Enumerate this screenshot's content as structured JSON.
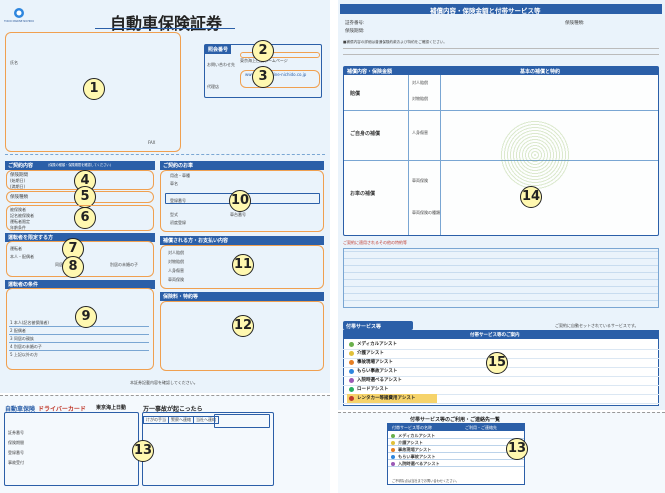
{
  "left_page": {
    "title": "自動車保険証券",
    "logo_text": "TOKIO MARINE NICHIDO",
    "contact_header": "照会番号",
    "contact_label": "お問い合わせ先",
    "contact_person": "代理店",
    "contact_web_header": "東京海上日動ホームページ",
    "contact_url": "www.tokiomarine-nichido.co.jp",
    "insured_label": "氏名",
    "fax_label": "FAX",
    "contract_section": "ご契約内容",
    "contract_note": "(保険の種類・保険期間を確認してください)",
    "rows_4": [
      "保険期間",
      "(始期日)",
      "(満期日)"
    ],
    "row_5": "保険種類",
    "rows_6": [
      "被保険者",
      "記名被保険者",
      "運転者限定",
      "年齢条件"
    ],
    "section_7": "運転者を限定する方",
    "rows_8": [
      "運転者",
      "本人・配偶者",
      "同居の親族",
      "別居の未婚の子"
    ],
    "section_9": "運転者の条件",
    "rows_9": [
      "1 本人(記名被保険者)",
      "2 配偶者",
      "3 同居の親族",
      "4 別居の未婚の子",
      "5 上記以外の方"
    ],
    "car_section": "ご契約のお車",
    "car_rows": [
      "用途・車種",
      "車名",
      "型式",
      "登録番号",
      "初度登録",
      "車台番号"
    ],
    "coverage_section": "補償される方・お支払い内容",
    "coverage_rows": [
      "対人賠償",
      "対物賠償",
      "人身傷害",
      "車両保険"
    ],
    "premium_section": "保険料・特約等",
    "bottom_note": "本証券記載内容を確認してください。",
    "num_labels": [
      "1",
      "2",
      "3",
      "4",
      "5",
      "6",
      "7",
      "8",
      "9",
      "10",
      "11",
      "12"
    ]
  },
  "bottom_left": {
    "card_title": "自動車保険",
    "card_subtitle": "ドライバーカード",
    "card_company": "東京海上日動",
    "accident_title": "万一事故が起こったら",
    "accident_btns": [
      "けがの手当",
      "警察へ連絡",
      "当社へ連絡"
    ],
    "card_rows": [
      "証券番号",
      "保険期間",
      "登録番号",
      "事故受付"
    ],
    "num_label": "13"
  },
  "right_page": {
    "title": "補償内容・保険金額と付帯サービス等",
    "ids": [
      "証券番号:",
      "保険期間:",
      "保険種類:"
    ],
    "notice": "■補償内容の詳細は普通保険約款および特約をご確認ください。",
    "table_header": "補償内容・保険金額",
    "table_col": "基本の補償と特約",
    "rows": [
      {
        "label": "賠償",
        "sub": [
          "対人賠償",
          "対物賠償"
        ]
      },
      {
        "label": "ご自身の補償",
        "sub": [
          "人身傷害"
        ]
      },
      {
        "label": "お車の補償",
        "sub": [
          "車両保険",
          "車両保険の種類"
        ]
      }
    ],
    "special_notice": "ご契約に適用されるその他の特約等",
    "num_labels": [
      "14",
      "15"
    ]
  },
  "services": {
    "header": "付帯サービス等",
    "subheader": "付帯サービス等のご案内",
    "note": "ご契約に自動セットされているサービスです。",
    "items": [
      {
        "name": "メディカルアシスト",
        "color": "#6ab04c"
      },
      {
        "name": "介護アシスト",
        "color": "#e1c03a"
      },
      {
        "name": "事故現場アシスト",
        "color": "#e67e22"
      },
      {
        "name": "もらい事故アシスト",
        "color": "#2e86de"
      },
      {
        "name": "入院時選べるアシスト",
        "color": "#9b59b6"
      },
      {
        "name": "ロードアシスト",
        "color": "#27ae60"
      },
      {
        "name": "レンタカー等諸費用アシスト",
        "color": "#c0392b"
      }
    ]
  },
  "services_summary": {
    "header": "付帯サービス等のご利用・ご連絡先一覧",
    "col1": "付帯サービス等の名称",
    "col2": "ご利用・ご連絡先",
    "items": [
      "メディカルアシスト",
      "介護アシスト",
      "事故現場アシスト",
      "もらい事故アシスト",
      "入院時選べるアシスト"
    ],
    "footnote": "ご不明な点は当社までお問い合わせください。",
    "num_label": "13"
  }
}
